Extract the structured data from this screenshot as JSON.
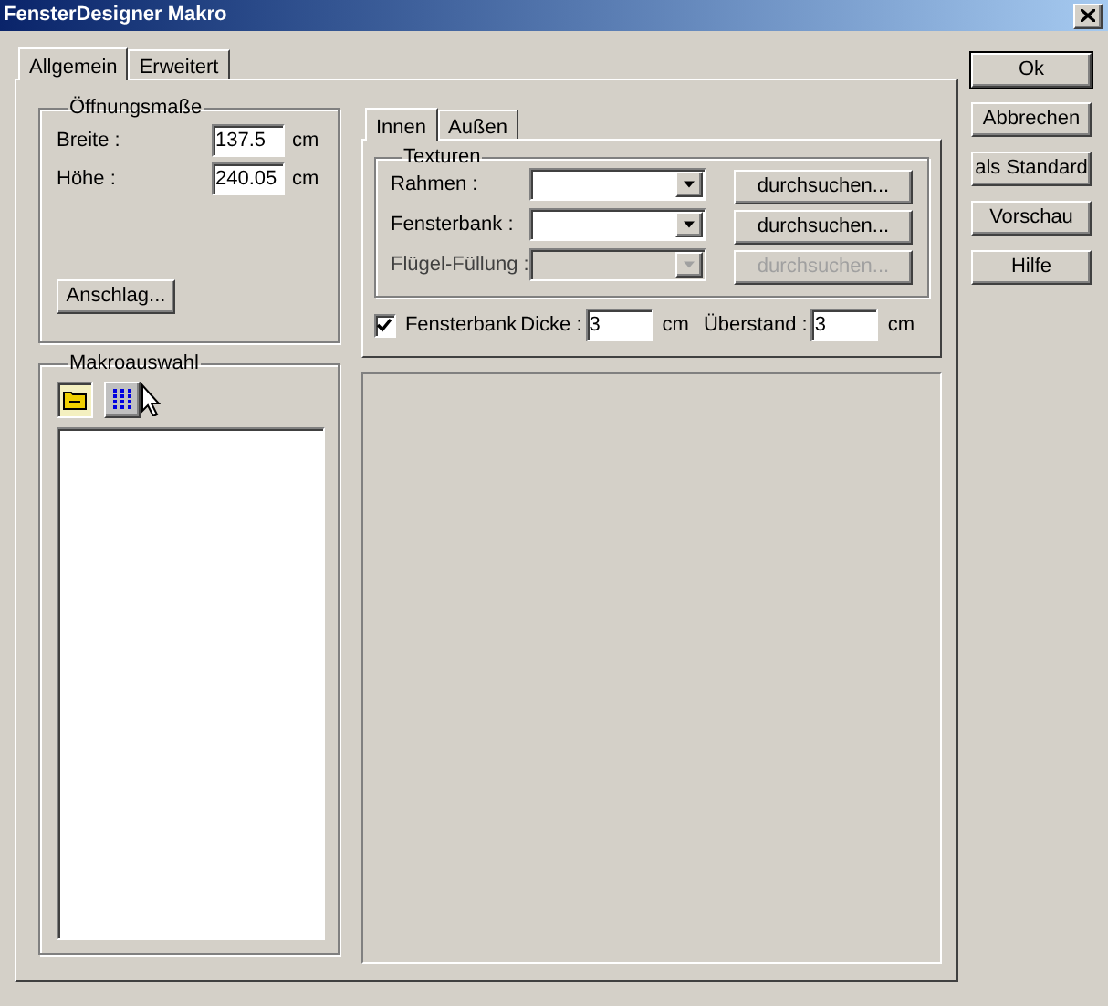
{
  "window": {
    "title": "FensterDesigner Makro"
  },
  "tabs": [
    {
      "label": "Allgemein",
      "selected": true
    },
    {
      "label": "Erweitert",
      "selected": false
    }
  ],
  "oeffnungsmasse": {
    "title": "Öffnungsmaße",
    "fields": [
      {
        "label": "Breite :",
        "value": "137.5",
        "unit": "cm"
      },
      {
        "label": "Höhe :",
        "value": "240.05",
        "unit": "cm"
      }
    ],
    "button": "Anschlag..."
  },
  "makroauswahl": {
    "title": "Makroauswahl"
  },
  "inner_tabs": [
    {
      "label": "Innen",
      "selected": true
    },
    {
      "label": "Außen",
      "selected": false
    }
  ],
  "texturen": {
    "title": "Texturen",
    "rows": [
      {
        "label": "Rahmen :",
        "disabled": false,
        "button": "durchsuchen..."
      },
      {
        "label": "Fensterbank :",
        "disabled": false,
        "button": "durchsuchen..."
      },
      {
        "label": "Flügel-Füllung :",
        "disabled": true,
        "button": "durchsuchen..."
      }
    ]
  },
  "fensterbank": {
    "label": "Fensterbank",
    "checked": true,
    "fields": [
      {
        "label": "Dicke :",
        "value": "3",
        "unit": "cm"
      },
      {
        "label": "Überstand :",
        "value": "3",
        "unit": "cm"
      }
    ]
  },
  "buttons": [
    {
      "label": "Ok",
      "default": true
    },
    {
      "label": "Abbrechen",
      "default": false
    },
    {
      "label": "als Standard",
      "default": false
    },
    {
      "label": "Vorschau",
      "default": false
    },
    {
      "label": "Hilfe",
      "default": false
    }
  ]
}
